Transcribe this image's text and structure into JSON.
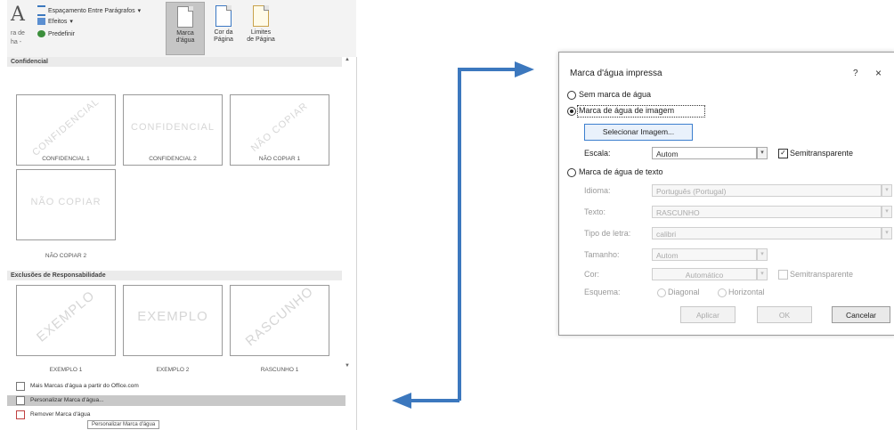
{
  "ribbon": {
    "big_letter": "A",
    "side_label_1": "ra de",
    "side_label_2": "ha -",
    "paragraph_spacing": "Espaçamento Entre Parágrafos",
    "effects": "Efeitos",
    "default": "Predefinir",
    "watermark_btn_line1": "Marca",
    "watermark_btn_line2": "d'água",
    "page_color_line1": "Cor da",
    "page_color_line2": "Página",
    "page_borders_line1": "Limites",
    "page_borders_line2": "de Página"
  },
  "gallery": {
    "section_confidential": "Confidencial",
    "section_disclaimers": "Exclusões de Responsabilidade",
    "thumbs_row1": [
      {
        "caption": "CONFIDENCIAL 1",
        "watermark": "CONFIDENCIAL"
      },
      {
        "caption": "CONFIDENCIAL 2",
        "watermark": "CONFIDENCIAL"
      },
      {
        "caption": "NÃO COPIAR 1",
        "watermark": "NÃO COPIAR"
      }
    ],
    "thumbs_row2": [
      {
        "caption": "NÃO COPIAR 2",
        "watermark": "NÃO COPIAR"
      }
    ],
    "thumbs_row3": [
      {
        "caption": "EXEMPLO 1",
        "watermark": "EXEMPLO"
      },
      {
        "caption": "EXEMPLO 2",
        "watermark": "EXEMPLO"
      },
      {
        "caption": "RASCUNHO 1",
        "watermark": "RASCUNHO"
      }
    ],
    "menu_more": "Mais Marcas d'água a partir do Office.com",
    "menu_custom": "Personalizar Marca d'água...",
    "menu_remove": "Remover Marca d'água",
    "tooltip": "Personalizar Marca d'água"
  },
  "dialog": {
    "title": "Marca d'água impressa",
    "help": "?",
    "close": "×",
    "no_watermark": "Sem marca de água",
    "picture_watermark": "Marca de água de imagem",
    "select_image": "Selecionar Imagem...",
    "scale_label": "Escala:",
    "scale_value": "Autom",
    "semitransparent": "Semitransparente",
    "text_watermark": "Marca de água de texto",
    "language_label": "Idioma:",
    "language_value": "Português (Portugal)",
    "text_label": "Texto:",
    "text_value": "RASCUNHO",
    "font_label": "Tipo de letra:",
    "font_value": "calibri",
    "size_label": "Tamanho:",
    "size_value": "Autom",
    "color_label": "Cor:",
    "color_value": "Automático",
    "semitransparent_text": "Semitransparente",
    "layout_label": "Esquema:",
    "diagonal": "Diagonal",
    "horizontal": "Horizontal",
    "apply": "Aplicar",
    "ok": "OK",
    "cancel": "Cancelar"
  },
  "colors": {
    "arrow": "#3c78be",
    "select_border": "#3c7fce",
    "highlight": "#c8c8c8"
  }
}
